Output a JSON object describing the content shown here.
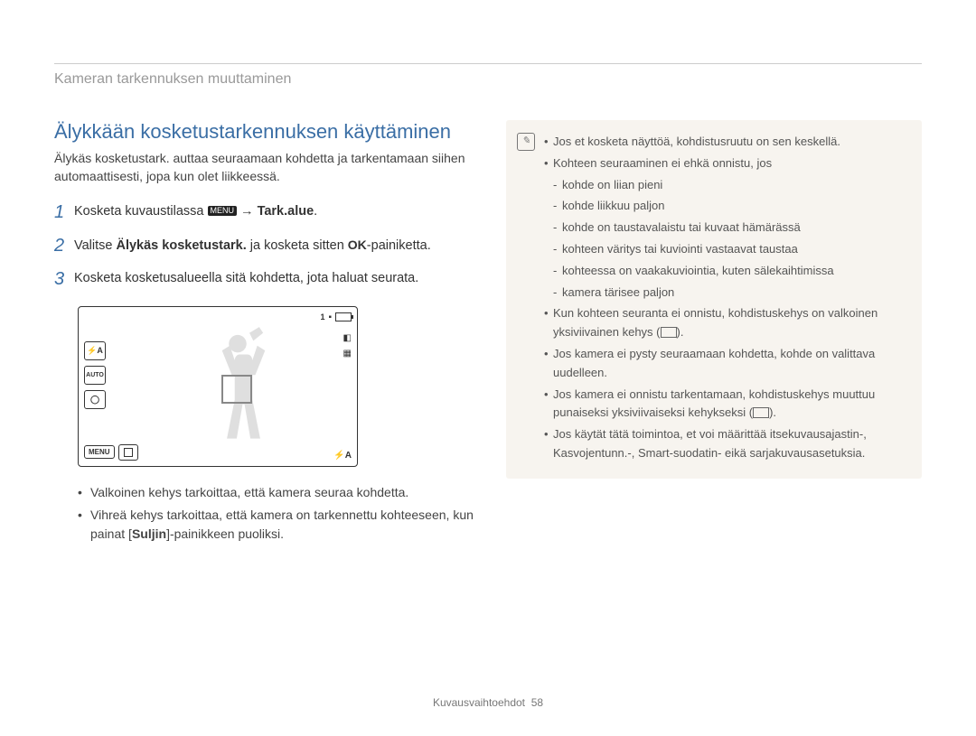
{
  "header": "Kameran tarkennuksen muuttaminen",
  "title": "Älykkään kosketustarkennuksen käyttäminen",
  "intro": "Älykäs kosketustark. auttaa seuraamaan kohdetta ja tarkentamaan siihen automaattisesti, jopa kun olet liikkeessä.",
  "steps": {
    "s1_a": "Kosketa kuvaustilassa ",
    "s1_menu": "MENU",
    "s1_b": " → ",
    "s1_c": "Tark.alue",
    "s1_d": ".",
    "s2_a": "Valitse ",
    "s2_b": "Älykäs kosketustark.",
    "s2_c": " ja kosketa sitten ",
    "s2_ok": "OK",
    "s2_d": "-painiketta.",
    "s3": "Kosketa kosketusalueella sitä kohdetta, jota haluat seurata."
  },
  "screenshot": {
    "top_right_count": "1",
    "menu_label": "MENU",
    "flash_label": "⚡A",
    "auto_label": "AUTO",
    "timer_label": "◯",
    "br_label": "⚡A"
  },
  "left_bullets": {
    "b1": "Valkoinen kehys tarkoittaa, että kamera seuraa kohdetta.",
    "b2_a": "Vihreä kehys tarkoittaa, että kamera on tarkennettu kohteeseen, kun painat [",
    "b2_b": "Suljin",
    "b2_c": "]-painikkeen puoliksi."
  },
  "note": {
    "n1": "Jos et kosketa näyttöä, kohdistusruutu on sen keskellä.",
    "n2": "Kohteen seuraaminen ei ehkä onnistu, jos",
    "n2a": "kohde on liian pieni",
    "n2b": "kohde liikkuu paljon",
    "n2c": "kohde on taustavalaistu tai kuvaat hämärässä",
    "n2d": "kohteen väritys tai kuviointi vastaavat taustaa",
    "n2e": "kohteessa on vaakakuviointia, kuten sälekaihtimissa",
    "n2f": "kamera tärisee paljon",
    "n3_a": "Kun kohteen seuranta ei onnistu, kohdistuskehys on valkoinen yksiviivainen kehys (",
    "n3_b": ").",
    "n4": "Jos kamera ei pysty seuraamaan kohdetta, kohde on valittava uudelleen.",
    "n5_a": "Jos kamera ei onnistu tarkentamaan, kohdistuskehys muuttuu punaiseksi yksiviivaiseksi kehykseksi (",
    "n5_b": ").",
    "n6": "Jos käytät tätä toimintoa, et voi määrittää itsekuvausajastin-, Kasvojentunn.-, Smart-suodatin- eikä sarjakuvausasetuksia."
  },
  "footer_a": "Kuvausvaihtoehdot",
  "footer_b": "58"
}
